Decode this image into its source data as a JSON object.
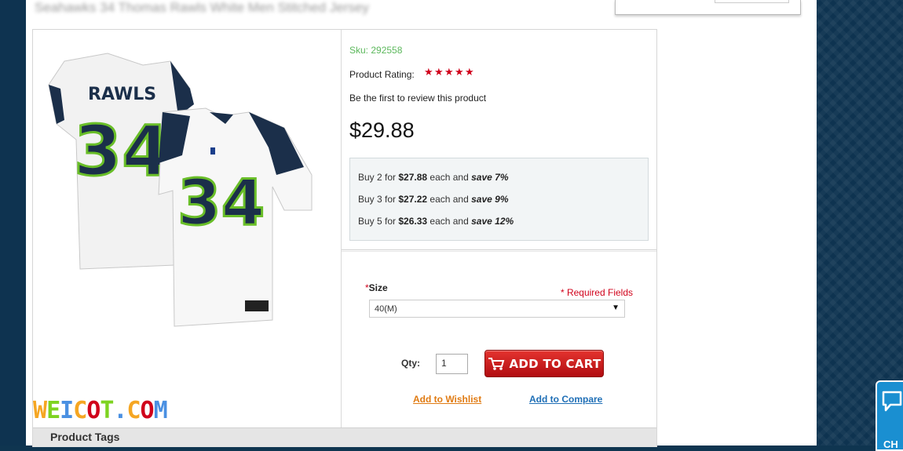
{
  "page": {
    "title_blurred": "Seahawks 34 Thomas Rawls White Men Stitched Jersey"
  },
  "product": {
    "sku": "Sku: 292558",
    "rating_label": "Product Rating:",
    "rating_stars": 5,
    "review_link": "Be the first to review this product",
    "price": "$29.88",
    "jersey_name": "RAWLS",
    "jersey_number": "34",
    "tiers": [
      {
        "prefix": "Buy 2 for ",
        "price": "$27.88",
        "mid": " each and ",
        "save": "save 7%"
      },
      {
        "prefix": "Buy 3 for ",
        "price": "$27.22",
        "mid": " each and ",
        "save": "save 9%"
      },
      {
        "prefix": "Buy 5 for ",
        "price": "$26.33",
        "mid": " each and ",
        "save": "save 12%"
      }
    ]
  },
  "options": {
    "size_asterisk": "*",
    "size_label": "Size",
    "required_note": "* Required Fields",
    "size_selected": "40(M)",
    "qty_label": "Qty:",
    "qty_value": "1",
    "add_to_cart": "ADD TO CART",
    "wishlist": "Add to Wishlist",
    "compare": "Add to Compare"
  },
  "tags": {
    "title": "Product Tags"
  },
  "watermark": {
    "letters": [
      "W",
      "E",
      "I",
      "C",
      "O",
      "T",
      ".",
      "C",
      "O",
      "M"
    ],
    "colors": [
      "#f5a623",
      "#7ed321",
      "#4a90e2",
      "#f5a623",
      "#d0021b",
      "#7ed321",
      "#4a90e2",
      "#f5a623",
      "#d0021b",
      "#4a90e2"
    ]
  },
  "chat": {
    "label": "CH"
  },
  "colors": {
    "sku": "#5cb85c",
    "star": "#d0021b",
    "cart_button": "#c8141a",
    "wishlist": "#e07b13",
    "compare": "#1f6fb6"
  }
}
